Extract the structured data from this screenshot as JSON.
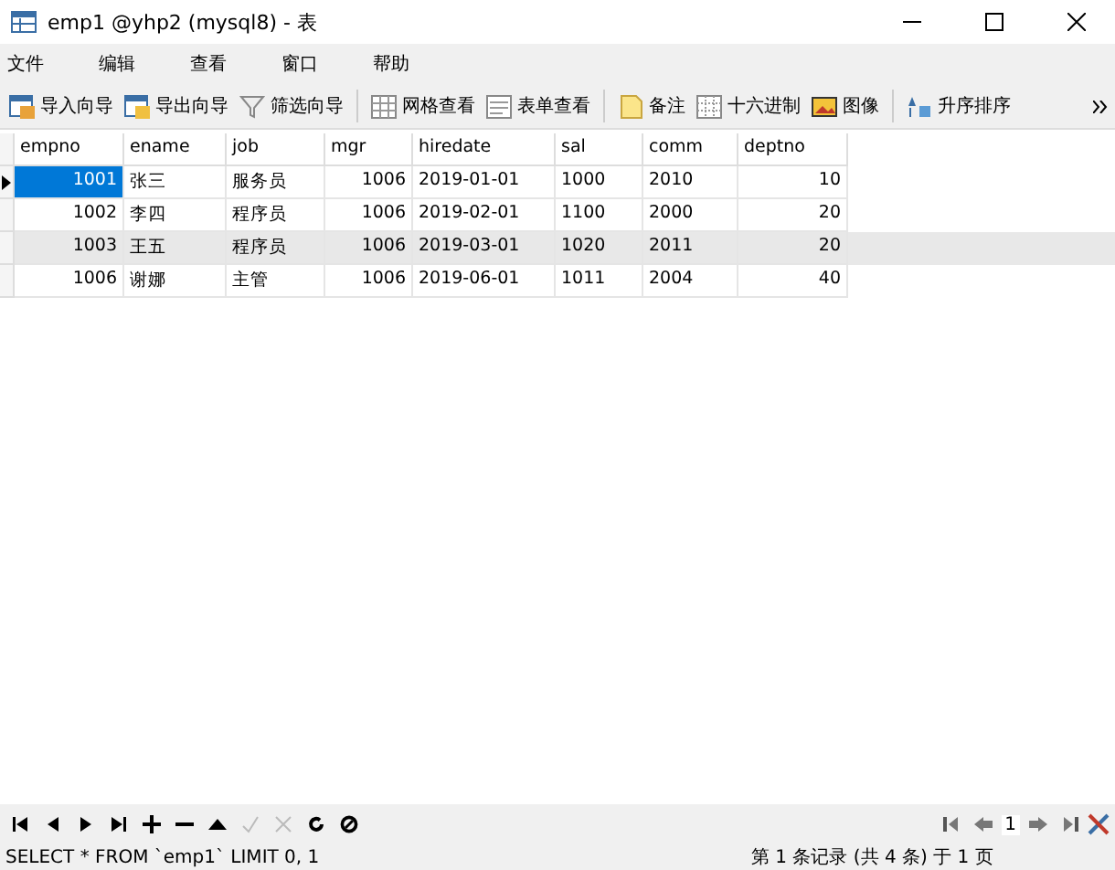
{
  "window": {
    "title": "emp1 @yhp2 (mysql8) - 表"
  },
  "menu": [
    "文件",
    "编辑",
    "查看",
    "窗口",
    "帮助"
  ],
  "toolbar": [
    {
      "kind": "import",
      "label": "导入向导"
    },
    {
      "kind": "export",
      "label": "导出向导"
    },
    {
      "kind": "filter",
      "label": "筛选向导"
    },
    {
      "kind": "grid",
      "label": "网格查看"
    },
    {
      "kind": "form",
      "label": "表单查看"
    },
    {
      "kind": "note",
      "label": "备注"
    },
    {
      "kind": "hex",
      "label": "十六进制"
    },
    {
      "kind": "image",
      "label": "图像"
    },
    {
      "kind": "sort",
      "label": "升序排序"
    }
  ],
  "table": {
    "columns": [
      "empno",
      "ename",
      "job",
      "mgr",
      "hiredate",
      "sal",
      "comm",
      "deptno"
    ],
    "rows": [
      {
        "selected": true,
        "hover": false,
        "cells": [
          "1001",
          "张三",
          "服务员",
          "1006",
          "2019-01-01",
          "1000",
          "2010",
          "10"
        ]
      },
      {
        "selected": false,
        "hover": false,
        "cells": [
          "1002",
          "李四",
          "程序员",
          "1006",
          "2019-02-01",
          "1100",
          "2000",
          "20"
        ]
      },
      {
        "selected": false,
        "hover": true,
        "cells": [
          "1003",
          "王五",
          "程序员",
          "1006",
          "2019-03-01",
          "1020",
          "2011",
          "20"
        ]
      },
      {
        "selected": false,
        "hover": false,
        "cells": [
          "1006",
          "谢娜",
          "主管",
          "1006",
          "2019-06-01",
          "1011",
          "2004",
          "40"
        ]
      }
    ]
  },
  "nav": [
    {
      "kind": "first",
      "disabled": false
    },
    {
      "kind": "prev",
      "disabled": false
    },
    {
      "kind": "next",
      "disabled": false
    },
    {
      "kind": "last",
      "disabled": false
    },
    {
      "kind": "add",
      "disabled": false
    },
    {
      "kind": "remove",
      "disabled": false
    },
    {
      "kind": "up",
      "disabled": false
    },
    {
      "kind": "apply",
      "disabled": true
    },
    {
      "kind": "discard",
      "disabled": true
    },
    {
      "kind": "refresh",
      "disabled": false
    },
    {
      "kind": "stop",
      "disabled": false
    }
  ],
  "pager": {
    "page": "1"
  },
  "status": {
    "query": "SELECT * FROM `emp1` LIMIT 0, 1",
    "record": "第 1 条记录 (共 4 条) 于 1 页"
  }
}
